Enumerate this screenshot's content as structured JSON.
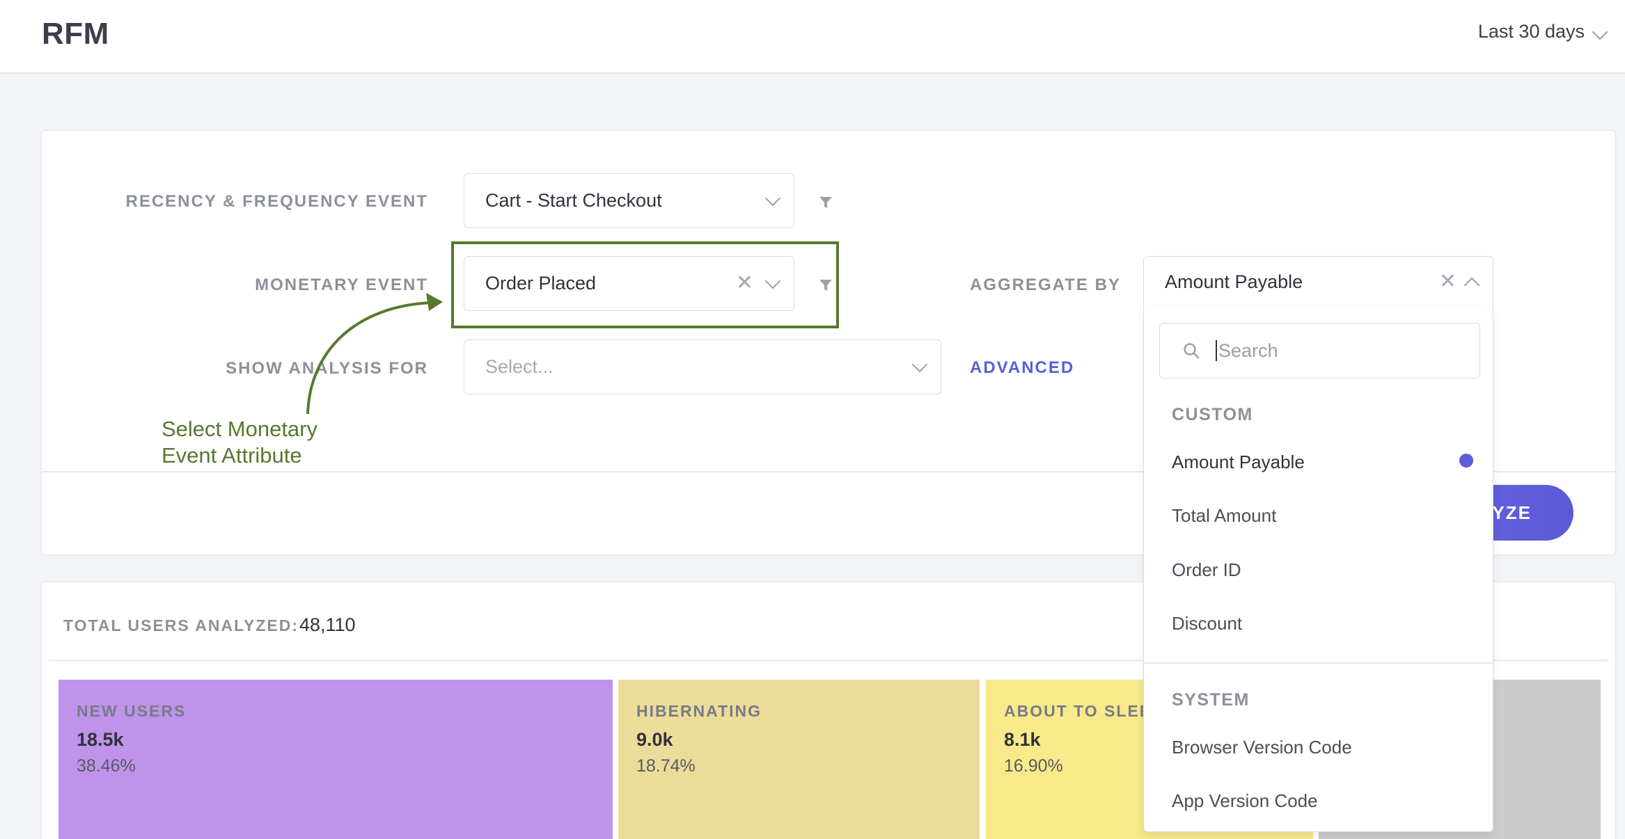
{
  "header": {
    "title": "RFM",
    "date_range": "Last 30 days"
  },
  "config": {
    "recency_frequency_label": "RECENCY & FREQUENCY EVENT",
    "recency_frequency_value": "Cart - Start Checkout",
    "monetary_label": "MONETARY EVENT",
    "monetary_value": "Order Placed",
    "show_analysis_label": "SHOW ANALYSIS FOR",
    "show_analysis_placeholder": "Select...",
    "aggregate_label": "AGGREGATE BY",
    "aggregate_value": "Amount Payable",
    "advanced_label": "ADVANCED",
    "analyze_label": "LYZE"
  },
  "annotation": {
    "line1": "Select Monetary",
    "line2": "Event Attribute",
    "color": "#56792e"
  },
  "results": {
    "total_label": "TOTAL USERS ANALYZED:",
    "total_value": "48,110",
    "tiles": [
      {
        "name": "NEW USERS",
        "count": "18.5k",
        "percent": "38.46%",
        "color": "#bf93ea"
      },
      {
        "name": "HIBERNATING",
        "count": "9.0k",
        "percent": "18.74%",
        "color": "#ecdc99"
      },
      {
        "name": "ABOUT TO SLEE",
        "count": "8.1k",
        "percent": "16.90%",
        "color": "#f8e98a"
      },
      {
        "name": "",
        "count": "",
        "percent": "",
        "color": "#cccccc"
      }
    ]
  },
  "dropdown": {
    "search_placeholder": "Search",
    "groups": [
      {
        "title": "CUSTOM",
        "options": [
          "Amount Payable",
          "Total Amount",
          "Order ID",
          "Discount"
        ]
      },
      {
        "title": "SYSTEM",
        "options": [
          "Browser Version Code",
          "App Version Code"
        ]
      }
    ],
    "selected_option": "Amount Payable",
    "accent_color": "#5c5fd8"
  },
  "icons": {
    "caret": "chevron-down-icon",
    "clear": "close-icon",
    "filter": "filter-icon",
    "search": "search-icon"
  }
}
